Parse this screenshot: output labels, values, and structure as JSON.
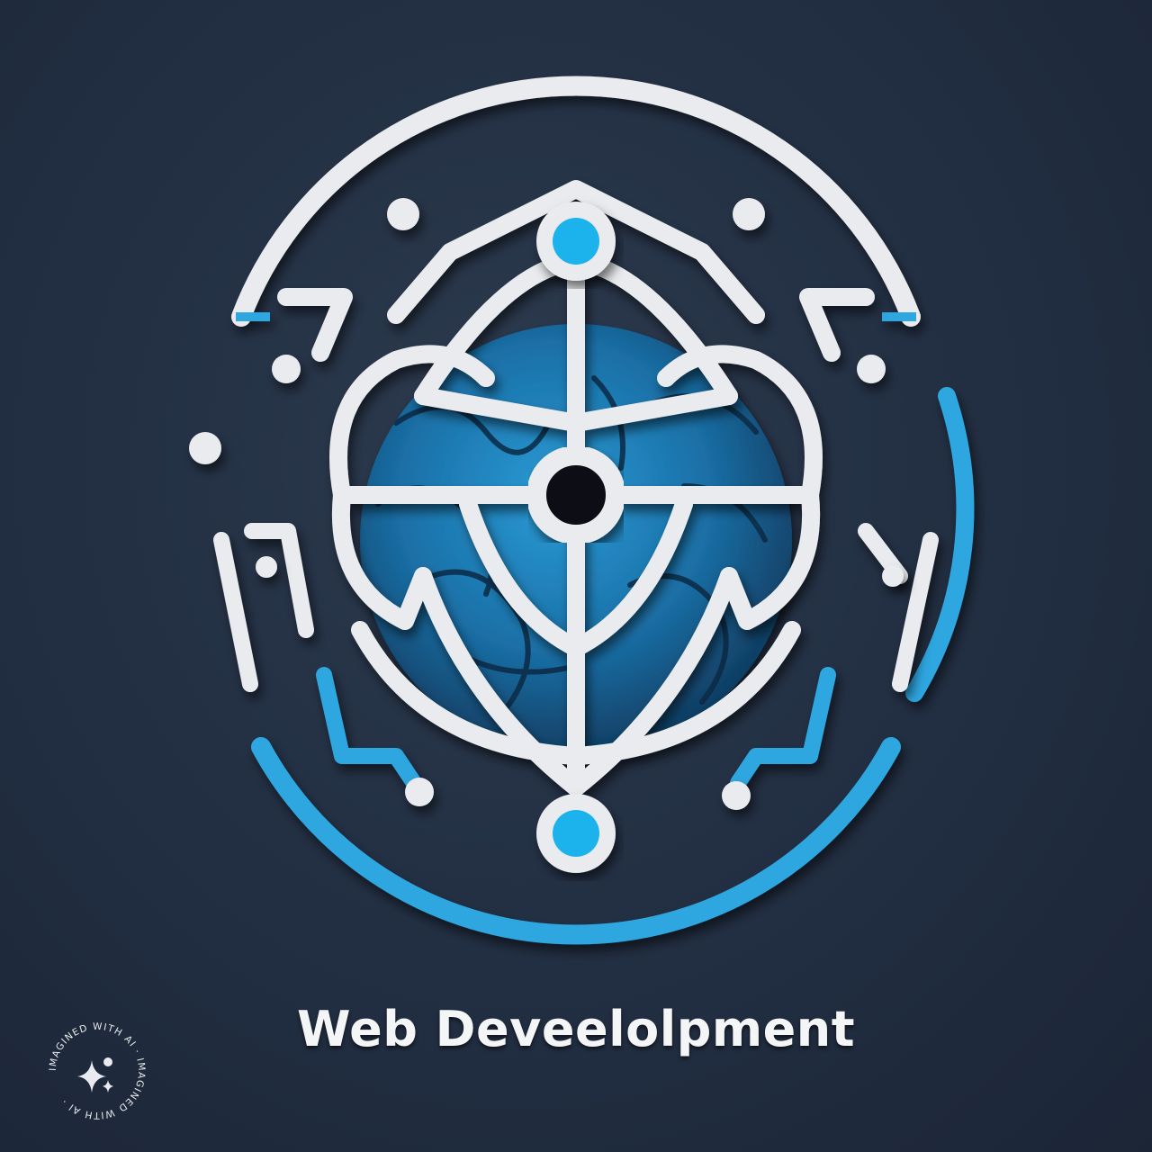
{
  "logo": {
    "caption": "Web Deveelolpment",
    "colors": {
      "background": "#233044",
      "line": "#e9ebee",
      "accent": "#2fa6e0",
      "node": "#1fb3ec",
      "globe": "#1f7fb8"
    }
  },
  "watermark": {
    "text": "IMAGINED WITH AI · IMAGINED WITH AI ·",
    "icon": "sparkle-icon"
  }
}
